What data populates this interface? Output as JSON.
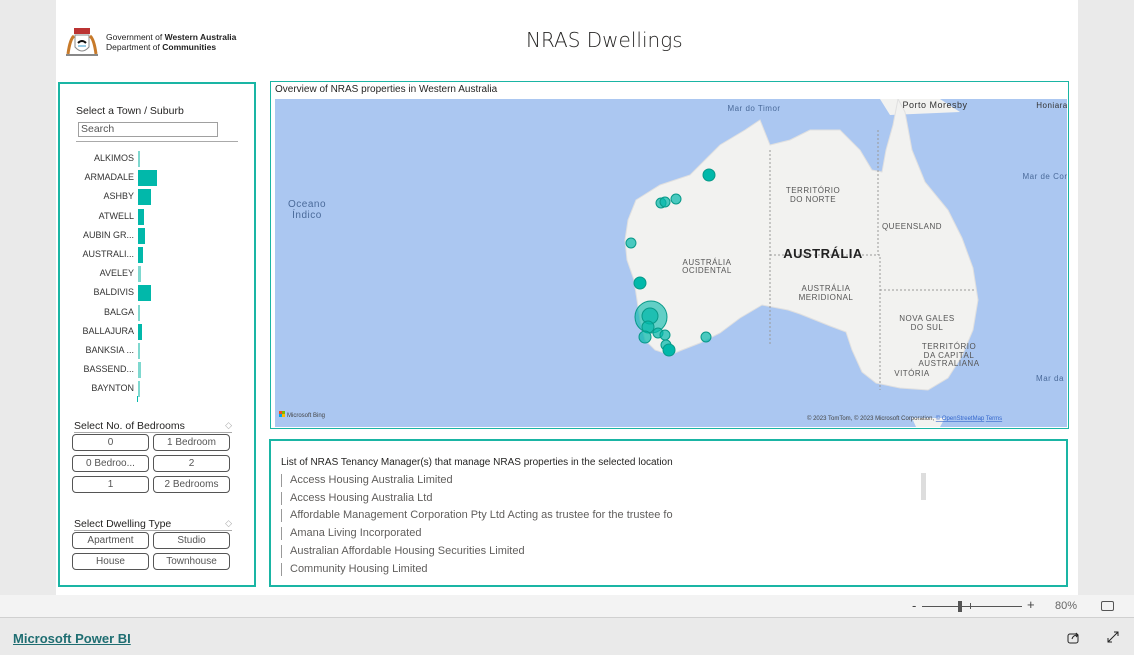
{
  "header": {
    "logo_line1_regular": "Government of ",
    "logo_line1_bold": "Western Australia",
    "logo_line2_regular": "Department of ",
    "logo_line2_bold": "Communities",
    "title": "NRAS Dwellings"
  },
  "town_slicer": {
    "title": "Select a Town / Suburb",
    "search_placeholder": "Search",
    "items": [
      {
        "label": "ALKIMOS",
        "value": 1
      },
      {
        "label": "ARMADALE",
        "value": 10
      },
      {
        "label": "ASHBY",
        "value": 7
      },
      {
        "label": "ATWELL",
        "value": 3
      },
      {
        "label": "AUBIN GR...",
        "value": 3.5
      },
      {
        "label": "AUSTRALI...",
        "value": 2.5
      },
      {
        "label": "AVELEY",
        "value": 1.5
      },
      {
        "label": "BALDIVIS",
        "value": 7
      },
      {
        "label": "BALGA",
        "value": 1
      },
      {
        "label": "BALLAJURA",
        "value": 2
      },
      {
        "label": "BANKSIA ...",
        "value": 1
      },
      {
        "label": "BASSEND...",
        "value": 1.5
      },
      {
        "label": "BAYNTON",
        "value": 0.7
      }
    ],
    "bar_color": "#01b8aa"
  },
  "bedroom_slicer": {
    "title": "Select No. of Bedrooms",
    "options": [
      "0",
      "1 Bedroom",
      "0 Bedroo...",
      "2",
      "1",
      "2 Bedrooms"
    ],
    "clear_icon": "eraser-icon"
  },
  "dwelling_slicer": {
    "title": "Select Dwelling Type",
    "options": [
      "Apartment",
      "Studio",
      "House",
      "Townhouse"
    ],
    "clear_icon": "eraser-icon"
  },
  "map": {
    "title": "Overview of NRAS properties in Western Australia",
    "labels": {
      "ocean": "Oceano",
      "ocean2": "Índico",
      "timor": "Mar do Timor",
      "port_moresby": "Porto Moresby",
      "honiara": "Honiara",
      "coral": "Mar de Cor",
      "nt1": "TERRITÓRIO",
      "nt2": "DO NORTE",
      "qld": "QUEENSLAND",
      "country": "AUSTRÁLIA",
      "wa1": "AUSTRÁLIA",
      "wa2": "OCIDENTAL",
      "sa1": "AUSTRÁLIA",
      "sa2": "MERIDIONAL",
      "nsw1": "NOVA GALES",
      "nsw2": "DO SUL",
      "act1": "TERRITÓRIO",
      "act2": "DA CAPITAL",
      "act3": "AUSTRALIANA",
      "vic": "VITÓRIA",
      "tasman": "Mar da"
    },
    "attribution": "© 2023 TomTom, © 2023 Microsoft Corporation, ",
    "osm": "© OpenStreetMap",
    "terms": "Terms",
    "bing": "Microsoft Bing",
    "bubble_color": "#01b8aa"
  },
  "managers": {
    "title": "List of NRAS Tenancy Manager(s) that manage NRAS properties in the selected location",
    "items": [
      "Access Housing Australia Limited",
      "Access Housing Australia Ltd",
      "Affordable Management Corporation Pty Ltd Acting as trustee for the trustee fo",
      "Amana Living Incorporated",
      "Australian Affordable Housing Securities Limited",
      "Community Housing Limited"
    ]
  },
  "zoom": {
    "minus": "-",
    "plus": "+",
    "level": "80%",
    "level_fraction": 0.8
  },
  "footer": {
    "brand": "Microsoft Power BI"
  },
  "colors": {
    "accent": "#1ab5a4",
    "water": "#abc7f1",
    "land": "#f2f2f0"
  }
}
